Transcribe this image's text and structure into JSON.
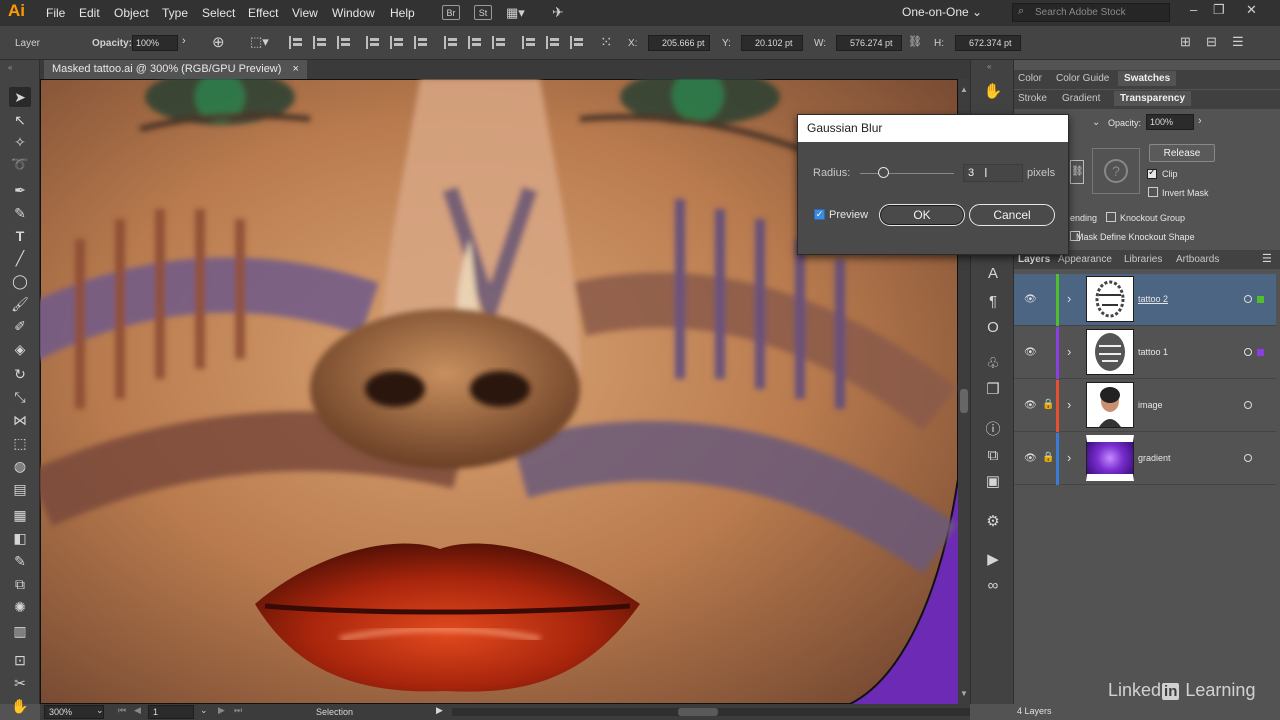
{
  "app": {
    "logo": "Ai",
    "workspace": "One-on-One",
    "stock_search_placeholder": "Search Adobe Stock"
  },
  "menu": [
    "File",
    "Edit",
    "Object",
    "Type",
    "Select",
    "Effect",
    "View",
    "Window",
    "Help"
  ],
  "menubar_icons": {
    "bridge": "Br",
    "stock": "St"
  },
  "control": {
    "selection_label": "Layer",
    "opacity_label": "Opacity:",
    "opacity_value": "100%",
    "x_label": "X:",
    "x_value": "205.666 pt",
    "y_label": "Y:",
    "y_value": "20.102 pt",
    "w_label": "W:",
    "w_value": "576.274 pt",
    "h_label": "H:",
    "h_value": "672.374 pt"
  },
  "document": {
    "tab_title": "Masked tattoo.ai @ 300% (RGB/GPU Preview)",
    "close": "×"
  },
  "status": {
    "zoom": "300%",
    "artboard": "1",
    "tool_status": "Selection"
  },
  "panels": {
    "top_tabs": [
      "Color",
      "Color Guide",
      "Swatches"
    ],
    "second_tabs": [
      "Stroke",
      "Gradient",
      "Transparency"
    ],
    "opacity_label": "Opacity:",
    "opacity_value": "100%",
    "release_button": "Release",
    "clip_label": "Clip",
    "invert_mask_label": "Invert Mask",
    "blending_fragment": "ending",
    "knockout_group_label": "Knockout Group",
    "mask_knockout_label": "Mask Define Knockout Shape",
    "layers_tabs": [
      "Layers",
      "Appearance",
      "Libraries",
      "Artboards"
    ],
    "layers": [
      {
        "name": "tattoo 2",
        "color": "#4fc02a",
        "locked": false,
        "selected": true
      },
      {
        "name": "tattoo 1",
        "color": "#8a3fe0",
        "locked": false,
        "selected": false
      },
      {
        "name": "image",
        "color": "#e5502f",
        "locked": true,
        "selected": false
      },
      {
        "name": "gradient",
        "color": "#3a7bd5",
        "locked": true,
        "selected": false
      }
    ],
    "layers_count": "4 Layers"
  },
  "dialog": {
    "title": "Gaussian Blur",
    "radius_label": "Radius:",
    "radius_value": "3",
    "units": "pixels",
    "slider_fraction": 0.24,
    "preview_label": "Preview",
    "preview_checked": true,
    "ok_label": "OK",
    "cancel_label": "Cancel"
  },
  "watermark": {
    "part1": "Linked",
    "part2": "in",
    "part3": " Learning"
  }
}
